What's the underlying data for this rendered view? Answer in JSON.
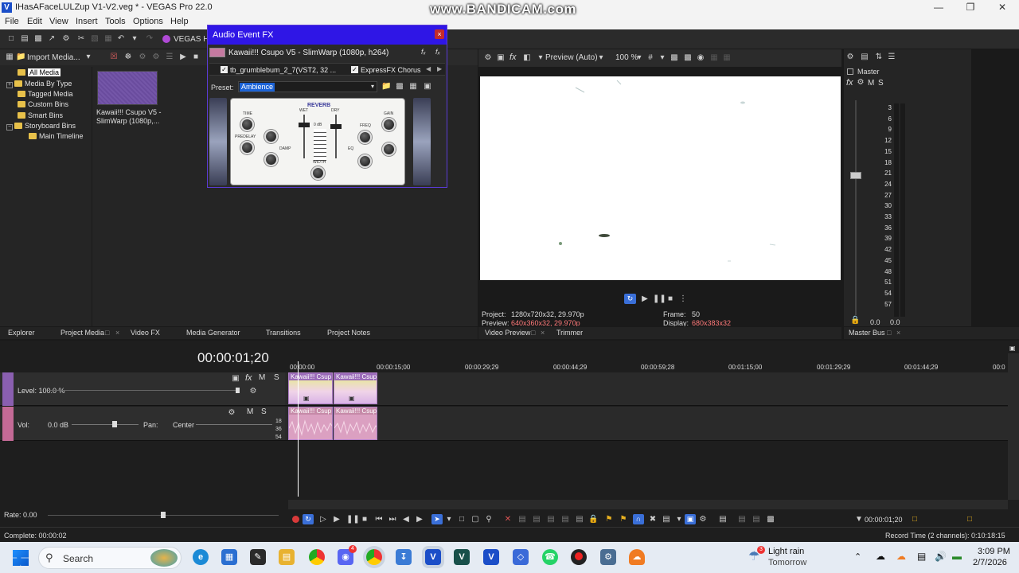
{
  "window": {
    "title": "IHasAFaceLULZup V1-V2.veg * - VEGAS Pro 22.0",
    "watermark": "www.BANDICAM.com",
    "app_icon": "V"
  },
  "menu": [
    "File",
    "Edit",
    "View",
    "Insert",
    "Tools",
    "Options",
    "Help"
  ],
  "toolbar": {
    "vegas_label": "VEGAS Hu"
  },
  "explorer": {
    "import_label": "Import Media...",
    "tree": [
      "All Media",
      "Media By Type",
      "Tagged Media",
      "Custom Bins",
      "Smart Bins",
      "Storyboard Bins",
      "Main Timeline"
    ],
    "media_item": "Kawaii!!! Csupo V5 - SlimWarp (1080p,..."
  },
  "left_tabs": [
    "Explorer",
    "Project Media",
    "Video FX",
    "Media Generator",
    "Transitions",
    "Project Notes"
  ],
  "fx_dialog": {
    "title": "Audio Event FX",
    "event_name": "Kawaii!!! Csupo V5 - SlimWarp (1080p, h264)",
    "chain": [
      "tb_grumblebum_2_7(VST2, 32 ...",
      "ExpressFX Chorus"
    ],
    "preset_label": "Preset:",
    "preset_value": "Ambience",
    "plugin": {
      "name": "REVERB",
      "labels": [
        "TIME",
        "PREDELAY",
        "DAMP",
        "WET",
        "DRY",
        "WIDTH",
        "FREQ",
        "GAIN",
        "EQ"
      ],
      "meter_text": "0 dB"
    }
  },
  "preview": {
    "mode": "Preview (Auto)",
    "zoom": "100 %",
    "project_label": "Project:",
    "project_value": "1280x720x32, 29.970p",
    "preview_label": "Preview:",
    "preview_value": "640x360x32, 29.970p",
    "frame_label": "Frame:",
    "frame_value": "50",
    "display_label": "Display:",
    "display_value": "680x383x32",
    "tabs": [
      "Video Preview",
      "Trimmer"
    ]
  },
  "master": {
    "title": "Master",
    "controls": [
      "M",
      "S"
    ],
    "scale": [
      "3",
      "6",
      "9",
      "12",
      "15",
      "18",
      "21",
      "24",
      "27",
      "30",
      "33",
      "36",
      "39",
      "42",
      "45",
      "48",
      "51",
      "54",
      "57"
    ],
    "values": [
      "0.0",
      "0.0"
    ],
    "tab": "Master Bus"
  },
  "timeline": {
    "timecode": "00:00:01;20",
    "ruler": [
      "00:00:00",
      "00:00:15;00",
      "00:00:29;29",
      "00:00:44;29",
      "00:00:59;28",
      "00:01:15;00",
      "00:01:29;29",
      "00:01:44;29",
      "00:0"
    ],
    "video_track": {
      "level": "Level: 100.0 %",
      "m": "M",
      "s": "S",
      "fx": "fx"
    },
    "audio_track": {
      "vol_label": "Vol:",
      "vol_value": "0.0 dB",
      "pan_label": "Pan:",
      "pan_value": "Center",
      "m": "M",
      "s": "S",
      "scale": [
        "18",
        "36",
        "54"
      ]
    },
    "clip_label": "Kawaii!!! Csup",
    "rate": "Rate: 0.00",
    "cursor_time": "00:00:01;20"
  },
  "status": {
    "complete": "Complete: 00:00:02",
    "record_time": "Record Time (2 channels): 0:10:18:15"
  },
  "taskbar": {
    "search": "Search",
    "weather": "Light rain",
    "weather_sub": "Tomorrow",
    "weather_badge": "3",
    "discord_badge": "4",
    "time": "3:09 PM",
    "date": "2/7/2026"
  }
}
